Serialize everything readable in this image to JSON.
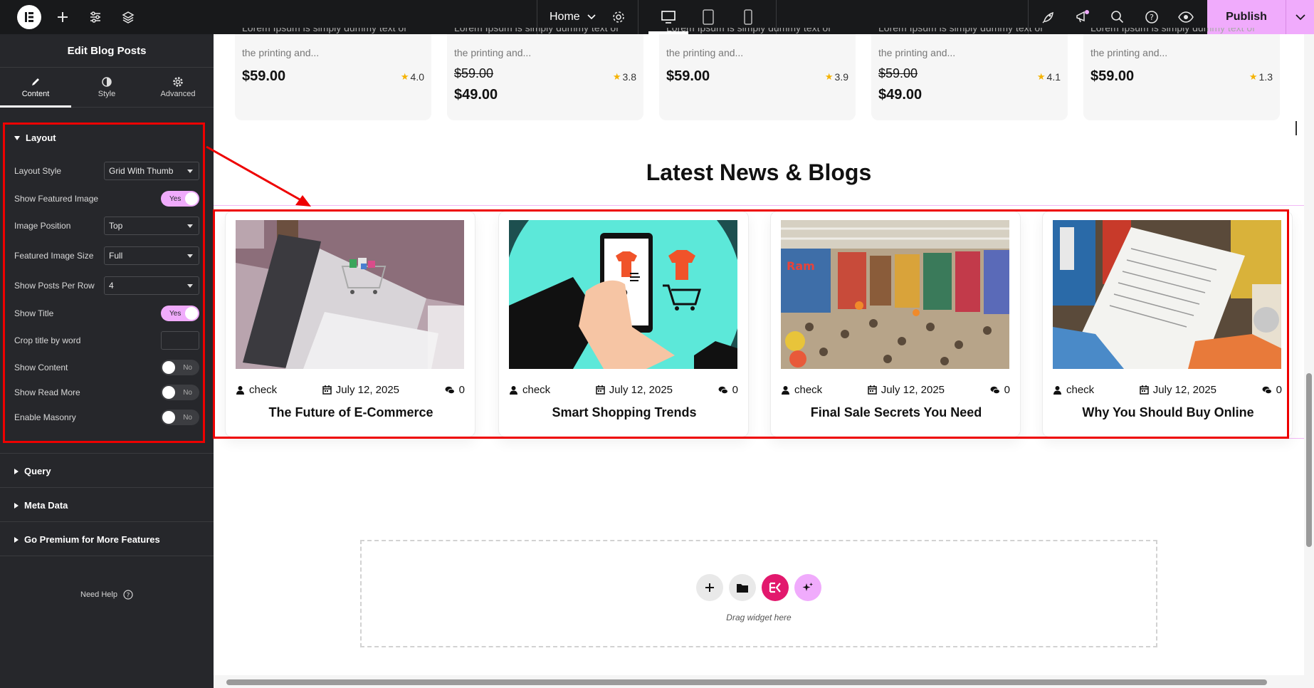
{
  "topbar": {
    "page_name": "Home",
    "publish_label": "Publish"
  },
  "sidebar": {
    "title": "Edit Blog Posts",
    "tabs": [
      {
        "label": "Content",
        "icon": "pencil-icon"
      },
      {
        "label": "Style",
        "icon": "contrast-icon"
      },
      {
        "label": "Advanced",
        "icon": "gear-icon"
      }
    ],
    "layout_section": {
      "title": "Layout",
      "controls": [
        {
          "label": "Layout Style",
          "type": "select",
          "value": "Grid With Thumb"
        },
        {
          "label": "Show Featured Image",
          "type": "toggle",
          "value": "Yes"
        },
        {
          "label": "Image Position",
          "type": "select",
          "value": "Top"
        },
        {
          "label": "Featured Image Size",
          "type": "select",
          "value": "Full"
        },
        {
          "label": "Show Posts Per Row",
          "type": "select",
          "value": "4"
        },
        {
          "label": "Show Title",
          "type": "toggle",
          "value": "Yes"
        },
        {
          "label": "Crop title by word",
          "type": "input",
          "value": ""
        },
        {
          "label": "Show Content",
          "type": "toggle",
          "value": "No"
        },
        {
          "label": "Show Read More",
          "type": "toggle",
          "value": "No"
        },
        {
          "label": "Enable Masonry",
          "type": "toggle",
          "value": "No"
        }
      ]
    },
    "sections": [
      "Query",
      "Meta Data",
      "Go Premium for More Features"
    ],
    "need_help": "Need Help"
  },
  "products": [
    {
      "desc1": "Lorem Ipsum is simply dummy text of",
      "desc2": "the printing and...",
      "price": "$59.00",
      "old_price": "",
      "rating": "4.0"
    },
    {
      "desc1": "Lorem Ipsum is simply dummy text of",
      "desc2": "the printing and...",
      "price": "$49.00",
      "old_price": "$59.00",
      "rating": "3.8"
    },
    {
      "desc1": "Lorem Ipsum is simply dummy text of",
      "desc2": "the printing and...",
      "price": "$59.00",
      "old_price": "",
      "rating": "3.9"
    },
    {
      "desc1": "Lorem Ipsum is simply dummy text of",
      "desc2": "the printing and...",
      "price": "$49.00",
      "old_price": "$59.00",
      "rating": "4.1"
    },
    {
      "desc1": "Lorem Ipsum is simply dummy text of",
      "desc2": "the printing and...",
      "price": "$59.00",
      "old_price": "",
      "rating": "1.3"
    }
  ],
  "blog_section": {
    "title": "Latest News & Blogs",
    "posts": [
      {
        "author": "check",
        "date": "July 12, 2025",
        "comments": "0",
        "title": "The Future of E-Commerce",
        "image": "laptop-shopping-cart-image"
      },
      {
        "author": "check",
        "date": "July 12, 2025",
        "comments": "0",
        "title": "Smart Shopping Trends",
        "image": "phone-shopping-illustration"
      },
      {
        "author": "check",
        "date": "July 12, 2025",
        "comments": "0",
        "title": "Final Sale Secrets You Need",
        "image": "supermarket-crowd-image"
      },
      {
        "author": "check",
        "date": "July 12, 2025",
        "comments": "0",
        "title": "Why You Should Buy Online",
        "image": "grocery-receipt-image"
      }
    ]
  },
  "dropzone": {
    "label": "Drag widget here"
  },
  "colors": {
    "accent": "#f0abfc",
    "highlight": "#ee0000",
    "dark": "#26272b",
    "elementor_pink": "#e2186d"
  }
}
